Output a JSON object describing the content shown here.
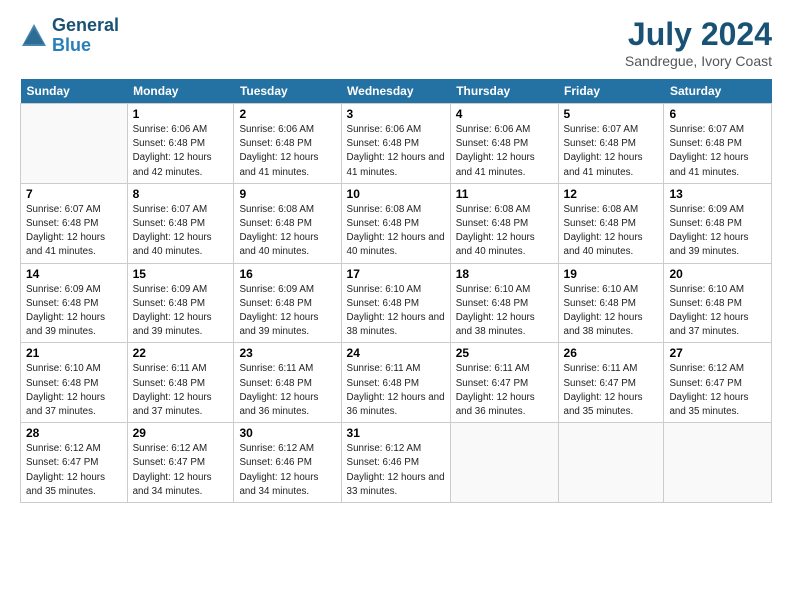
{
  "header": {
    "logo_line1": "General",
    "logo_line2": "Blue",
    "month_year": "July 2024",
    "location": "Sandregue, Ivory Coast"
  },
  "weekdays": [
    "Sunday",
    "Monday",
    "Tuesday",
    "Wednesday",
    "Thursday",
    "Friday",
    "Saturday"
  ],
  "weeks": [
    [
      {
        "day": null
      },
      {
        "day": "1",
        "sunrise": "6:06 AM",
        "sunset": "6:48 PM",
        "daylight": "12 hours and 42 minutes."
      },
      {
        "day": "2",
        "sunrise": "6:06 AM",
        "sunset": "6:48 PM",
        "daylight": "12 hours and 41 minutes."
      },
      {
        "day": "3",
        "sunrise": "6:06 AM",
        "sunset": "6:48 PM",
        "daylight": "12 hours and 41 minutes."
      },
      {
        "day": "4",
        "sunrise": "6:06 AM",
        "sunset": "6:48 PM",
        "daylight": "12 hours and 41 minutes."
      },
      {
        "day": "5",
        "sunrise": "6:07 AM",
        "sunset": "6:48 PM",
        "daylight": "12 hours and 41 minutes."
      },
      {
        "day": "6",
        "sunrise": "6:07 AM",
        "sunset": "6:48 PM",
        "daylight": "12 hours and 41 minutes."
      }
    ],
    [
      {
        "day": "7",
        "sunrise": "6:07 AM",
        "sunset": "6:48 PM",
        "daylight": "12 hours and 41 minutes."
      },
      {
        "day": "8",
        "sunrise": "6:07 AM",
        "sunset": "6:48 PM",
        "daylight": "12 hours and 40 minutes."
      },
      {
        "day": "9",
        "sunrise": "6:08 AM",
        "sunset": "6:48 PM",
        "daylight": "12 hours and 40 minutes."
      },
      {
        "day": "10",
        "sunrise": "6:08 AM",
        "sunset": "6:48 PM",
        "daylight": "12 hours and 40 minutes."
      },
      {
        "day": "11",
        "sunrise": "6:08 AM",
        "sunset": "6:48 PM",
        "daylight": "12 hours and 40 minutes."
      },
      {
        "day": "12",
        "sunrise": "6:08 AM",
        "sunset": "6:48 PM",
        "daylight": "12 hours and 40 minutes."
      },
      {
        "day": "13",
        "sunrise": "6:09 AM",
        "sunset": "6:48 PM",
        "daylight": "12 hours and 39 minutes."
      }
    ],
    [
      {
        "day": "14",
        "sunrise": "6:09 AM",
        "sunset": "6:48 PM",
        "daylight": "12 hours and 39 minutes."
      },
      {
        "day": "15",
        "sunrise": "6:09 AM",
        "sunset": "6:48 PM",
        "daylight": "12 hours and 39 minutes."
      },
      {
        "day": "16",
        "sunrise": "6:09 AM",
        "sunset": "6:48 PM",
        "daylight": "12 hours and 39 minutes."
      },
      {
        "day": "17",
        "sunrise": "6:10 AM",
        "sunset": "6:48 PM",
        "daylight": "12 hours and 38 minutes."
      },
      {
        "day": "18",
        "sunrise": "6:10 AM",
        "sunset": "6:48 PM",
        "daylight": "12 hours and 38 minutes."
      },
      {
        "day": "19",
        "sunrise": "6:10 AM",
        "sunset": "6:48 PM",
        "daylight": "12 hours and 38 minutes."
      },
      {
        "day": "20",
        "sunrise": "6:10 AM",
        "sunset": "6:48 PM",
        "daylight": "12 hours and 37 minutes."
      }
    ],
    [
      {
        "day": "21",
        "sunrise": "6:10 AM",
        "sunset": "6:48 PM",
        "daylight": "12 hours and 37 minutes."
      },
      {
        "day": "22",
        "sunrise": "6:11 AM",
        "sunset": "6:48 PM",
        "daylight": "12 hours and 37 minutes."
      },
      {
        "day": "23",
        "sunrise": "6:11 AM",
        "sunset": "6:48 PM",
        "daylight": "12 hours and 36 minutes."
      },
      {
        "day": "24",
        "sunrise": "6:11 AM",
        "sunset": "6:48 PM",
        "daylight": "12 hours and 36 minutes."
      },
      {
        "day": "25",
        "sunrise": "6:11 AM",
        "sunset": "6:47 PM",
        "daylight": "12 hours and 36 minutes."
      },
      {
        "day": "26",
        "sunrise": "6:11 AM",
        "sunset": "6:47 PM",
        "daylight": "12 hours and 35 minutes."
      },
      {
        "day": "27",
        "sunrise": "6:12 AM",
        "sunset": "6:47 PM",
        "daylight": "12 hours and 35 minutes."
      }
    ],
    [
      {
        "day": "28",
        "sunrise": "6:12 AM",
        "sunset": "6:47 PM",
        "daylight": "12 hours and 35 minutes."
      },
      {
        "day": "29",
        "sunrise": "6:12 AM",
        "sunset": "6:47 PM",
        "daylight": "12 hours and 34 minutes."
      },
      {
        "day": "30",
        "sunrise": "6:12 AM",
        "sunset": "6:46 PM",
        "daylight": "12 hours and 34 minutes."
      },
      {
        "day": "31",
        "sunrise": "6:12 AM",
        "sunset": "6:46 PM",
        "daylight": "12 hours and 33 minutes."
      },
      {
        "day": null
      },
      {
        "day": null
      },
      {
        "day": null
      }
    ]
  ]
}
